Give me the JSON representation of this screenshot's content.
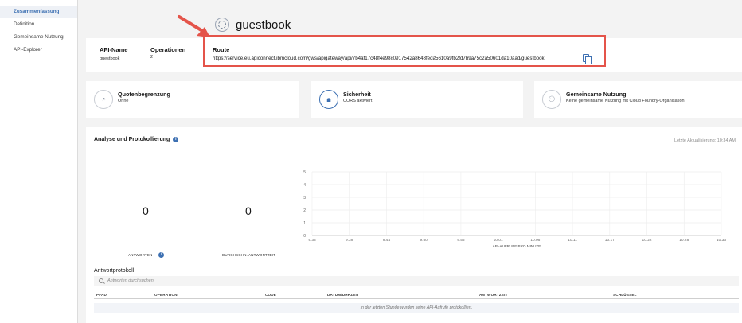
{
  "sidebar": {
    "items": [
      {
        "label": "Zusammenfassung",
        "active": true
      },
      {
        "label": "Definition",
        "active": false
      },
      {
        "label": "Gemeinsame Nutzung",
        "active": false
      },
      {
        "label": "API-Explorer",
        "active": false
      }
    ]
  },
  "header": {
    "service_name": "guestbook"
  },
  "info": {
    "api_name_label": "API-Name",
    "api_name_value": "guestbook",
    "operations_label": "Operationen",
    "operations_value": "2",
    "route_label": "Route",
    "route_url": "https://service.eu.apiconnect.ibmcloud.com/gws/apigateway/api/7b4af17c48f4e98c0917542a8648feda5610a9fb2fd7b9a75c2a50601da10aad/guestbook"
  },
  "tiles": [
    {
      "title": "Quotenbegrenzung",
      "subtitle": "Ohne",
      "icon": "quota-icon"
    },
    {
      "title": "Sicherheit",
      "subtitle": "CORS aktiviert",
      "icon": "lock-icon"
    },
    {
      "title": "Gemeinsame Nutzung",
      "subtitle": "Keine gemeinsame Nutzung mit Cloud Foundry-Organisation",
      "icon": "share-icon"
    }
  ],
  "analytics": {
    "title": "Analyse und Protokollierung",
    "last_update": "Letzte Aktualisierung: 10:34 AM",
    "responses_value": "0",
    "responses_label": "ANTWORTEN",
    "avg_time_value": "0",
    "avg_time_label": "DURCHSCHN. ANTWORTZEIT"
  },
  "chart_data": {
    "type": "line",
    "x": [
      "9:33",
      "9:39",
      "9:44",
      "9:50",
      "9:55",
      "10:01",
      "10:06",
      "10:11",
      "10:17",
      "10:22",
      "10:28",
      "10:33"
    ],
    "series": [
      {
        "values": []
      }
    ],
    "ylim": [
      0,
      5
    ],
    "yticks": [
      0,
      1,
      2,
      3,
      4,
      5
    ],
    "xlabel": "API-AUFRUFE PRO MINUTE",
    "ylabel": "",
    "grid": true
  },
  "log": {
    "title": "Antwortprotokoll",
    "search_placeholder": "Antworten durchsuchen",
    "columns": [
      "PFAD",
      "OPERATION",
      "CODE",
      "DATUM/UHRZEIT",
      "ANTWORTZEIT",
      "SCHLÜSSEL"
    ],
    "empty_message": "In der letzten Stunde wurden keine API-Aufrufe protokolliert."
  },
  "colors": {
    "accent": "#3d70b2",
    "highlight": "#e4544a"
  }
}
